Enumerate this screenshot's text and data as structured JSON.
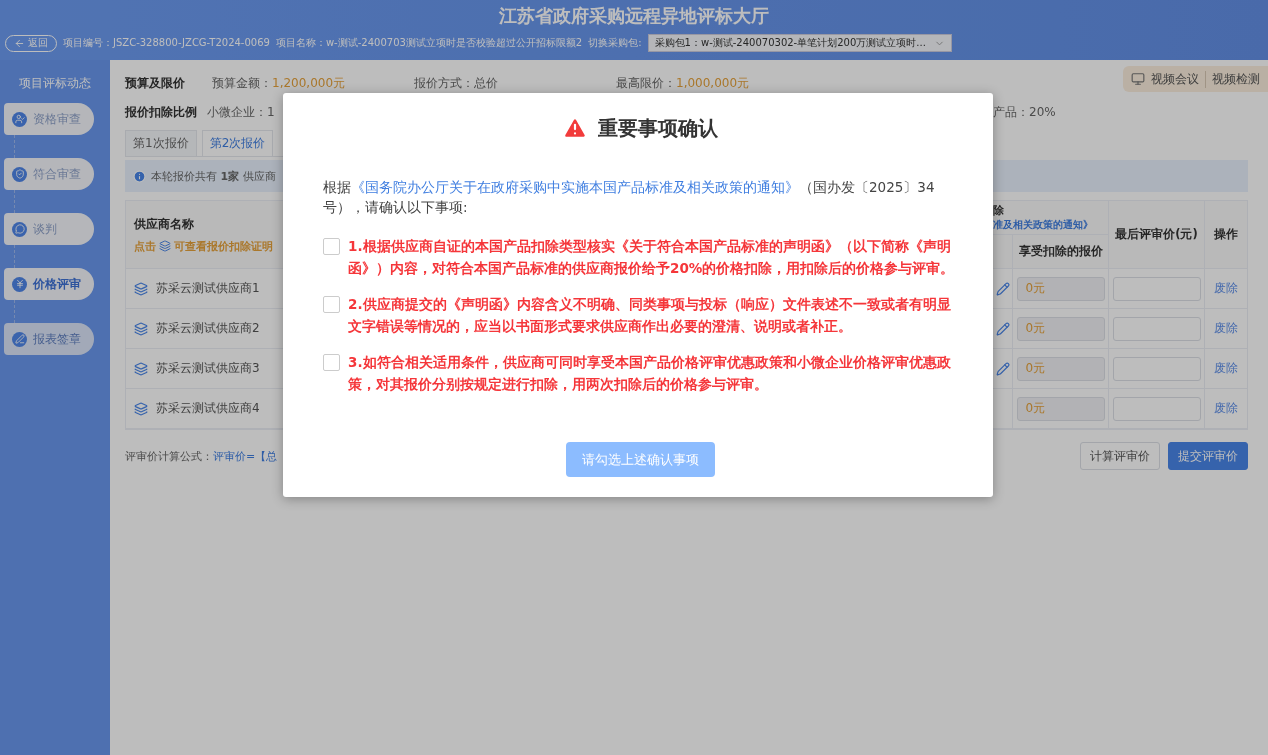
{
  "header": {
    "title": "江苏省政府采购远程异地评标大厅",
    "back_button": "返回",
    "project_fields": [
      "项目编号：JSZC-328800-JZCG-T2024-0069",
      "项目名称：w-测试-2400703测试立项时是否校验超过公开招标限额2"
    ],
    "package_switch": {
      "label": "切换采购包:",
      "value": "采购包1：w-测试-240070302-单笔计划200万测试立项时..."
    }
  },
  "video_tools": [
    "视频会议",
    "视频检测"
  ],
  "sidebar": {
    "title": "项目评标动态",
    "items": [
      {
        "label": "资格审查",
        "selected": false,
        "disabled": false
      },
      {
        "label": "符合审查",
        "selected": false,
        "disabled": false
      },
      {
        "label": "谈判",
        "selected": false,
        "disabled": false
      },
      {
        "label": "价格评审",
        "selected": true,
        "disabled": false
      },
      {
        "label": "报表签章",
        "selected": false,
        "disabled": true
      }
    ]
  },
  "budget": {
    "title": "预算及限价",
    "fields": [
      {
        "label": "预算金额：",
        "value": "1,200,000元",
        "highlight": true
      },
      {
        "label": "报价方式：",
        "value": "总价",
        "highlight": false
      },
      {
        "label": "最高限价：",
        "value": "1,000,000元",
        "highlight": true
      }
    ]
  },
  "deduction": {
    "title": "报价扣除比例",
    "left_text": "小微企业：1",
    "right_text": "产品：20%"
  },
  "rounds": [
    {
      "label": "第1次报价",
      "selected": false
    },
    {
      "label": "第2次报价",
      "selected": true
    }
  ],
  "notice": "本轮报价共有 **1家** 供应商",
  "table": {
    "supplier_header": "供应商名称",
    "hint_prefix": "点击",
    "hint_link": "可查看报价扣除证明",
    "group_header": "除",
    "group_link": "准及相关政策的通知》",
    "deducted_header": "享受扣除的报价",
    "final_header": "最后评审价(元)",
    "action_header": "操作",
    "rows": [
      {
        "supplier": "苏采云测试供应商1",
        "editable": true,
        "deducted": "0元",
        "action": "废除"
      },
      {
        "supplier": "苏采云测试供应商2",
        "editable": true,
        "deducted": "0元",
        "action": "废除"
      },
      {
        "supplier": "苏采云测试供应商3",
        "editable": true,
        "deducted": "0元",
        "action": "废除"
      },
      {
        "supplier": "苏采云测试供应商4",
        "editable": false,
        "deducted": "0元",
        "action": "废除"
      }
    ]
  },
  "formula": {
    "label": "评审价计算公式：",
    "value": "评审价=【总"
  },
  "buttons": [
    {
      "label": "计算评审价",
      "kind": "secondary"
    },
    {
      "label": "提交评审价",
      "kind": "primary"
    }
  ],
  "dialog": {
    "title": "重要事项确认",
    "intro_prefix": "根据",
    "intro_link": "《国务院办公厅关于在政府采购中实施本国产品标准及相关政策的通知》",
    "intro_suffix": "（国办发〔2025〕34号），请确认以下事项:",
    "items": [
      {
        "text": "1.根据供应商自证的本国产品扣除类型核实《关于符合本国产品标准的声明函》（以下简称《声明函》）内容，对符合本国产品标准的供应商报价给予20%的价格扣除，用扣除后的价格参与评审。",
        "checked": false
      },
      {
        "text": "2.供应商提交的《声明函》内容含义不明确、同类事项与投标（响应）文件表述不一致或者有明显文字错误等情况的，应当以书面形式要求供应商作出必要的澄清、说明或者补正。",
        "checked": false
      },
      {
        "text": "3.如符合相关适用条件，供应商可同时享受本国产品价格评审优惠政策和小微企业价格评审优惠政策，对其报价分别按规定进行扣除，用两次扣除后的价格参与评审。",
        "checked": false
      }
    ],
    "confirm_button": {
      "label": "请勾选上述确认事项",
      "disabled": true
    }
  }
}
